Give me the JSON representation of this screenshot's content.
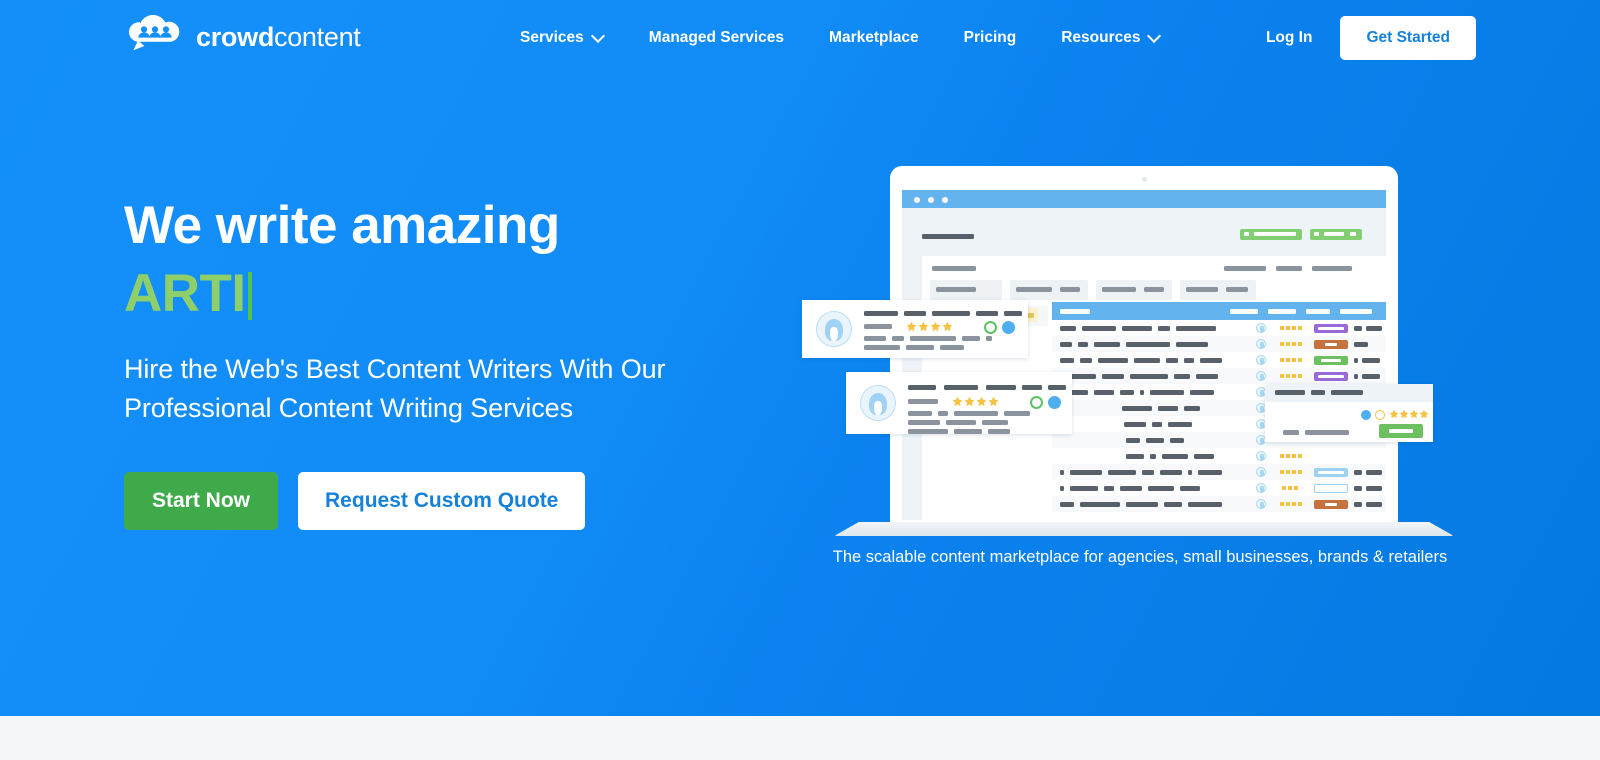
{
  "brand": {
    "logo_text_bold": "crowd",
    "logo_text_light": "content",
    "logo_icon": "cloud-people-logo-icon",
    "accent_blue": "#1590fa",
    "accent_blue_dark": "#0479e0",
    "accent_green": "#3faa4a",
    "typed_green": "#8fcf6a",
    "white": "#ffffff"
  },
  "nav": {
    "items": [
      {
        "label": "Services",
        "has_dropdown": true,
        "icon": "chevron-down-icon"
      },
      {
        "label": "Managed Services",
        "has_dropdown": false
      },
      {
        "label": "Marketplace",
        "has_dropdown": false
      },
      {
        "label": "Pricing",
        "has_dropdown": false
      },
      {
        "label": "Resources",
        "has_dropdown": true,
        "icon": "chevron-down-icon"
      }
    ],
    "login_label": "Log In",
    "get_started_label": "Get Started"
  },
  "hero": {
    "headline_static": "We write amazing",
    "headline_typed": "ARTI",
    "subheading": "Hire the Web's Best Content Writers With Our Professional Content Writing Services",
    "primary_cta": "Start Now",
    "secondary_cta": "Request Custom Quote",
    "illustration_caption": "The scalable content marketplace for agencies, small businesses, brands & retailers",
    "illustration_name": "laptop-marketplace-dashboard-illustration"
  }
}
